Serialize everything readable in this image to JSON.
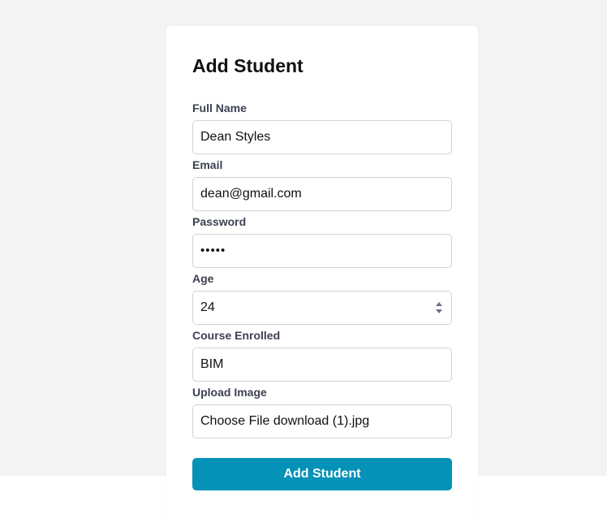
{
  "form": {
    "title": "Add Student",
    "fields": {
      "full_name": {
        "label": "Full Name",
        "value": "Dean Styles"
      },
      "email": {
        "label": "Email",
        "value": "dean@gmail.com"
      },
      "password": {
        "label": "Password",
        "value": "•••••"
      },
      "age": {
        "label": "Age",
        "value": "24"
      },
      "course": {
        "label": "Course Enrolled",
        "value": "BIM"
      },
      "image": {
        "label": "Upload Image",
        "button_label": "Choose File",
        "file_name": "download (1).jpg"
      }
    },
    "submit_label": "Add Student"
  },
  "colors": {
    "page_background": "#f2f3f5",
    "card_background": "#ffffff",
    "accent": "#0592b8",
    "label_text": "#3b4150",
    "input_border": "#cfd3d8"
  },
  "icons": {
    "age_spinner": "number-spinner-icon"
  }
}
